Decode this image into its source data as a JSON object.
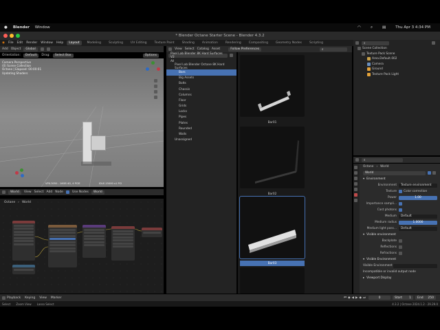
{
  "mac": {
    "app": "Blender",
    "menu": "Window",
    "datetime": "Thu Apr 3  4:34 PM"
  },
  "window": {
    "title": "* Blender Octane Starter Scene - Blender 4.3.2"
  },
  "menubar": {
    "items": [
      "File",
      "Edit",
      "Render",
      "Window",
      "Help"
    ],
    "workspaces": [
      "Layout",
      "Modeling",
      "Sculpting",
      "UV Editing",
      "Texture Paint",
      "Shading",
      "Animation",
      "Rendering",
      "Compositing",
      "Geometry Nodes",
      "Scripting"
    ],
    "scene": "Octane",
    "view_layer": "ViewLayer"
  },
  "viewport": {
    "header": [
      "Add",
      "Object"
    ],
    "orientation": "Global",
    "transform_label": "Orientation:",
    "transform_value": "Default",
    "drag_label": "Drag:",
    "drag_value": "Select Box",
    "options": "Options",
    "overlay_text": [
      "Camera Perspective",
      "(0) Scene Collection",
      "Octane | Elapsed: 00:00:01",
      "Updating Shaders"
    ],
    "ground_labels": [
      "VPX-3050 - 16GB 4G, 4 PCIE",
      "IDLE-15000 x1 PCI"
    ],
    "axis_labels": [
      "X",
      "Y",
      "Z"
    ]
  },
  "node_editor": {
    "header": [
      "World",
      "View",
      "Select",
      "Add",
      "Node"
    ],
    "use_nodes": "Use Nodes",
    "world": "World",
    "breadcrumb": [
      "Octane",
      "World"
    ]
  },
  "asset_browser": {
    "header": [
      "View",
      "Select",
      "Catalog",
      "Asset"
    ],
    "library": "Pixel Lab Blender 8K Hard Surfaces V2",
    "import": "Follow Preferences",
    "tree_all": "All",
    "tree_root": "Pixel Lab Blender Octane 8K Hard Surfaces",
    "items": [
      "Bars",
      "Big Assets",
      "Bolts",
      "Chassis",
      "Columns",
      "Floor",
      "Grids",
      "Locks",
      "Pipes",
      "Plates",
      "Rounded",
      "Walls"
    ],
    "unassigned": "Unassigned",
    "thumbs": [
      "Bar01",
      "Bar02",
      "Bar03"
    ]
  },
  "outliner": {
    "title": "Scene Collection",
    "items": [
      "Texture Pack Scene",
      "Area.Default.002",
      "Camera",
      "Ground",
      "Texture Pack Light"
    ]
  },
  "properties": {
    "tab_scene": "Octane",
    "tab_world": "World",
    "world_name": "World",
    "section_env": "Environment",
    "rows": [
      {
        "label": "Environment",
        "value": "Texture environment"
      },
      {
        "label": "Texture",
        "value": "Color correction",
        "check": true
      },
      {
        "label": "Power",
        "value": "1.00",
        "blue": true
      },
      {
        "label": "Importance sampli...",
        "value": "",
        "check": true
      },
      {
        "label": "Cast photons",
        "value": "",
        "check": true
      },
      {
        "label": "Medium",
        "value": "Default"
      },
      {
        "label": "Medium radius",
        "value": "1.0000",
        "blue": true
      },
      {
        "label": "Medium light pass...",
        "value": "Default"
      }
    ],
    "section_visible": "Visible environment",
    "visible_rows": [
      "Backplate",
      "Reflections",
      "Refractions"
    ],
    "section_visible2": "Visible Environment",
    "visible_env_label": "Visible Environment",
    "incompatible": "Incompatible or invalid output node",
    "viewport_display": "Viewport Display"
  },
  "timeline": {
    "items": [
      "Playback",
      "Keying",
      "View",
      "Marker"
    ],
    "frame": "0",
    "start_label": "Start",
    "start": "1",
    "end_label": "End",
    "end": "250"
  },
  "status": {
    "left": [
      "Select",
      "Zoom View",
      "Lasso Select"
    ],
    "right": "4.3.2 | Octane 2024.1.2 - 29.29.0"
  }
}
